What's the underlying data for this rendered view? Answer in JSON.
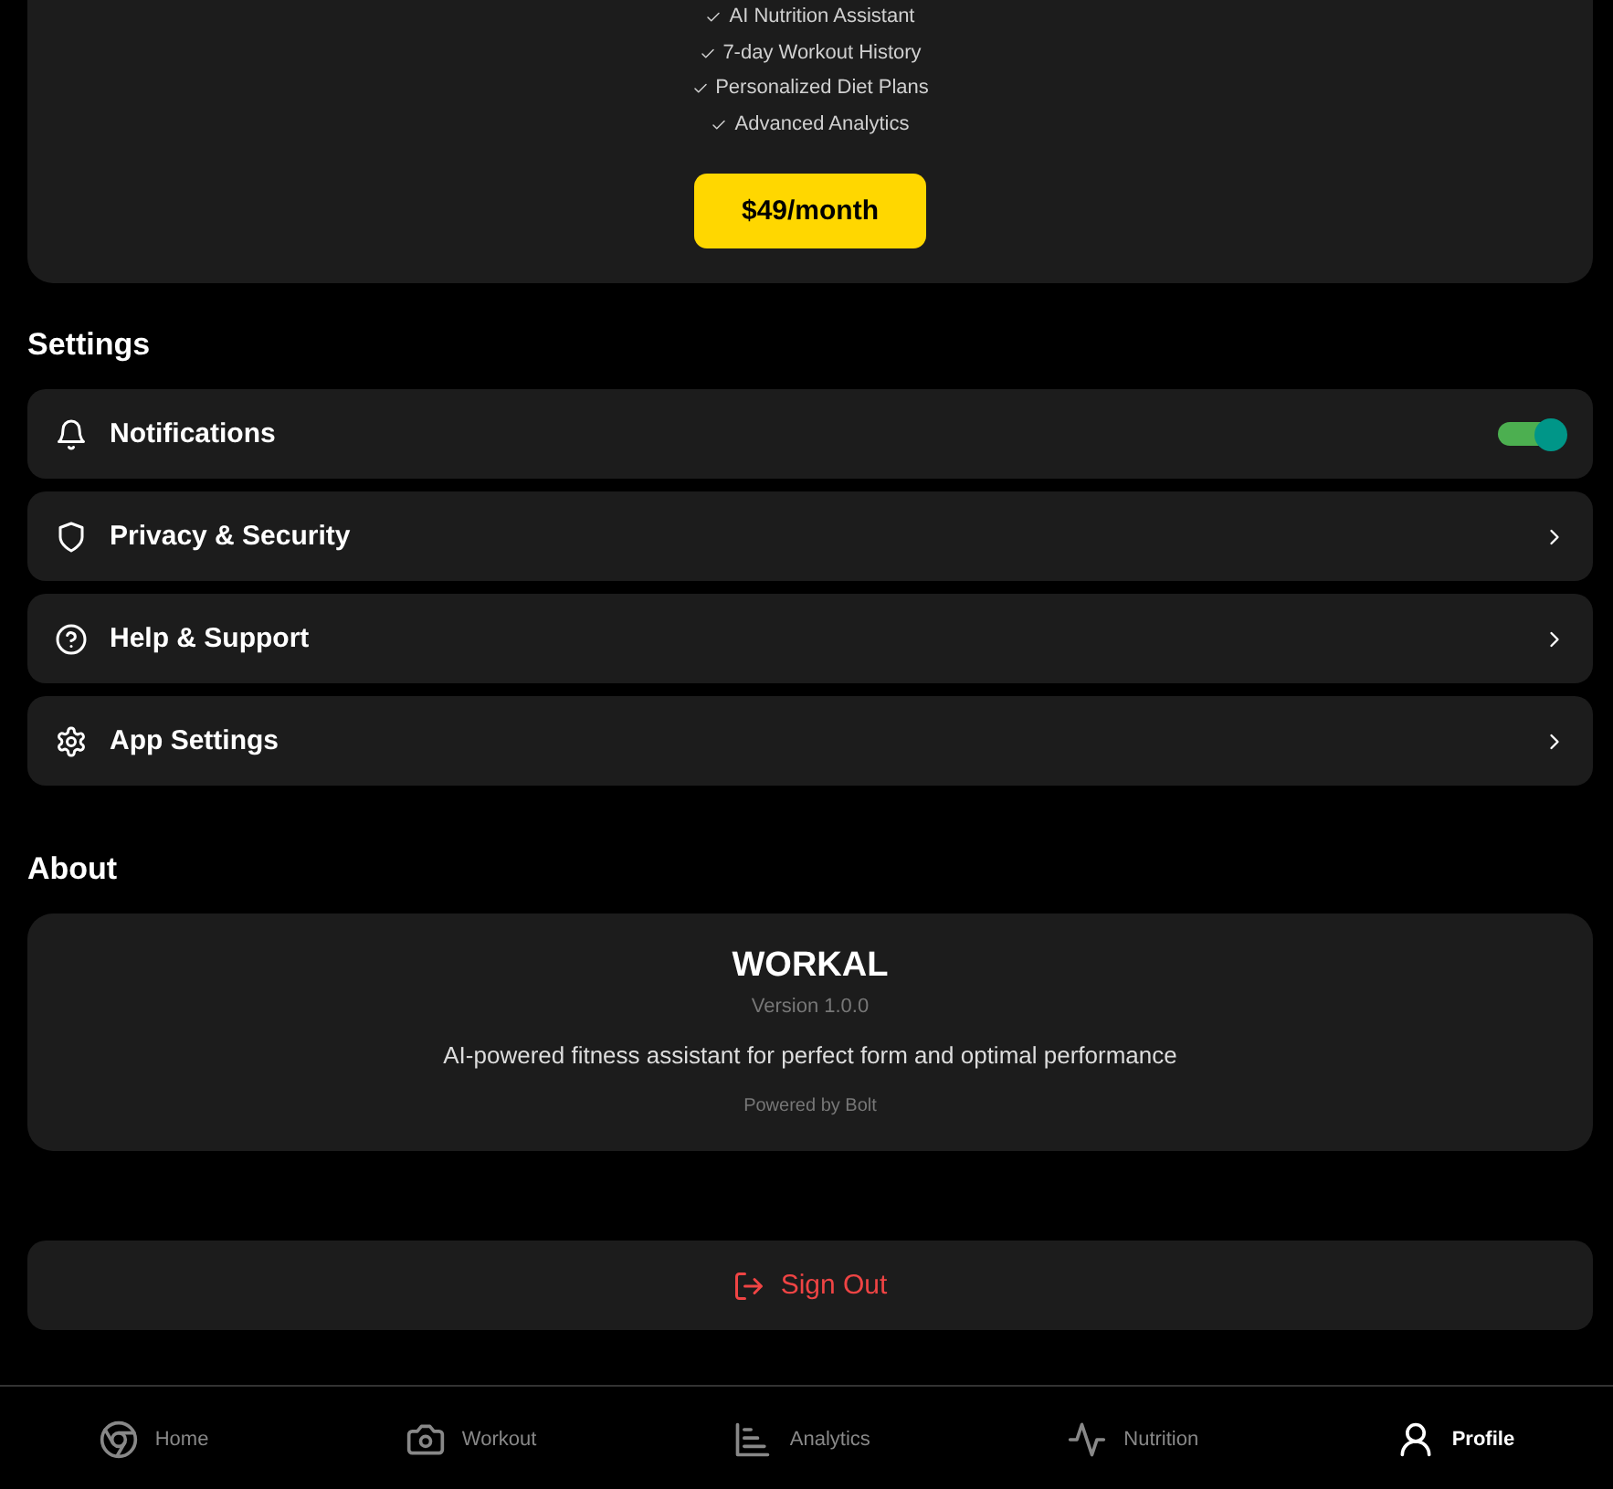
{
  "plan": {
    "features": [
      "AI Nutrition Assistant",
      "7-day Workout History",
      "Personalized Diet Plans",
      "Advanced Analytics"
    ],
    "price_button": "$49/month"
  },
  "settings": {
    "title": "Settings",
    "items": [
      {
        "label": "Notifications",
        "kind": "toggle",
        "on": true
      },
      {
        "label": "Privacy & Security",
        "kind": "link"
      },
      {
        "label": "Help & Support",
        "kind": "link"
      },
      {
        "label": "App Settings",
        "kind": "link"
      }
    ]
  },
  "about": {
    "title": "About",
    "app_name": "WORKAL",
    "version": "Version 1.0.0",
    "description": "AI-powered fitness assistant for perfect form and optimal performance",
    "powered_by": "Powered by Bolt"
  },
  "sign_out": "Sign Out",
  "nav": [
    {
      "label": "Home",
      "selected": false
    },
    {
      "label": "Workout",
      "selected": false
    },
    {
      "label": "Analytics",
      "selected": false
    },
    {
      "label": "Nutrition",
      "selected": false
    },
    {
      "label": "Profile",
      "selected": true
    }
  ]
}
